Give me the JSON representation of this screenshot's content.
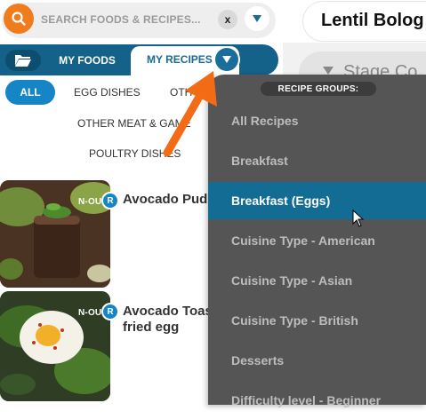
{
  "colors": {
    "accent_orange": "#f07c1e",
    "tab_blue": "#14618a",
    "chip_blue": "#1585c6",
    "dropdown_bg": "#555555",
    "dropdown_active": "#136c94"
  },
  "search": {
    "placeholder": "SEARCH FOODS & RECIPES...",
    "clear_label": "x",
    "search_icon": "search-icon",
    "dropdown_icon": "triangle-down-icon"
  },
  "recipe_header": {
    "title": "Lentil Bolog",
    "stage_text": "Stage Co"
  },
  "tabs": {
    "folder_icon": "folder-open-icon",
    "my_foods": "MY FOODS",
    "my_recipes": "MY RECIPES"
  },
  "filters": {
    "all": "ALL",
    "egg_dishes": "EGG DISHES",
    "other": "OTH",
    "other_meat_game": "OTHER MEAT & GAME",
    "poultry_dishes": "POULTRY DISHES"
  },
  "recipes": [
    {
      "badge": "N-OU",
      "r_badge": "R",
      "title": "Avocado Pud"
    },
    {
      "badge": "N-OU",
      "r_badge": "R",
      "title_line1": "Avocado Toas",
      "title_line2": "fried egg"
    }
  ],
  "dropdown": {
    "header": "RECIPE GROUPS:",
    "items": [
      "All Recipes",
      "Breakfast",
      "Breakfast (Eggs)",
      "Cuisine Type - American",
      "Cuisine Type - Asian",
      "Cuisine Type - British",
      "Desserts",
      "Difficulty level - Beginner"
    ],
    "active_index": 2
  }
}
